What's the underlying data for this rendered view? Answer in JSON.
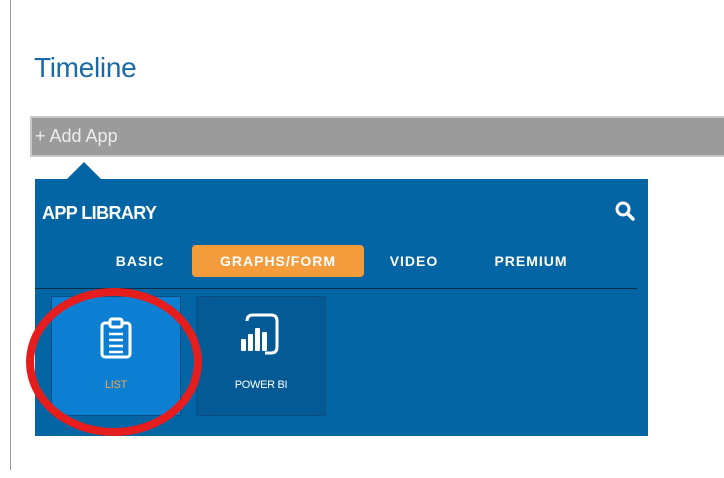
{
  "page": {
    "title": "Timeline"
  },
  "add_app": {
    "label": "+ Add App"
  },
  "library": {
    "title": "APP LIBRARY",
    "search_icon": "search-icon",
    "tabs": [
      {
        "label": "BASIC",
        "active": false
      },
      {
        "label": "GRAPHS/FORM",
        "active": true
      },
      {
        "label": "VIDEO",
        "active": false
      },
      {
        "label": "PREMIUM",
        "active": false
      }
    ],
    "apps": [
      {
        "label": "LIST",
        "icon": "clipboard-list-icon",
        "selected": true
      },
      {
        "label": "POWER BI",
        "icon": "power-bi-icon",
        "selected": false
      }
    ]
  },
  "colors": {
    "title": "#1a6aa8",
    "panel": "#0465a5",
    "active_tab": "#f49b3c",
    "selected_tile": "#0d7fd3",
    "highlight": "#e51d1d"
  }
}
